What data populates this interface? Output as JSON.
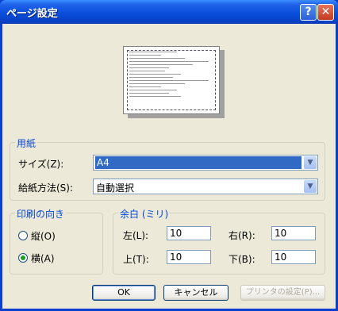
{
  "window": {
    "title": "ページ設定"
  },
  "title_buttons": {
    "help": "?",
    "close": "✕"
  },
  "paper": {
    "legend": "用紙",
    "size_label": "サイズ(Z):",
    "size_value": "A4",
    "source_label": "給紙方法(S):",
    "source_value": "自動選択"
  },
  "orientation": {
    "legend": "印刷の向き",
    "portrait_label": "縦(O)",
    "landscape_label": "横(A)",
    "selected": "landscape"
  },
  "margins": {
    "legend": "余白 (ミリ)",
    "left_label": "左(L):",
    "left_value": "10",
    "right_label": "右(R):",
    "right_value": "10",
    "top_label": "上(T):",
    "top_value": "10",
    "bottom_label": "下(B):",
    "bottom_value": "10"
  },
  "buttons": {
    "ok": "OK",
    "cancel": "キャンセル",
    "printer": "プリンタの設定(P)..."
  },
  "colors": {
    "legend_blue": "#0046D5",
    "titlebar_blue": "#0A4EDB",
    "selection_blue": "#316AC5"
  }
}
